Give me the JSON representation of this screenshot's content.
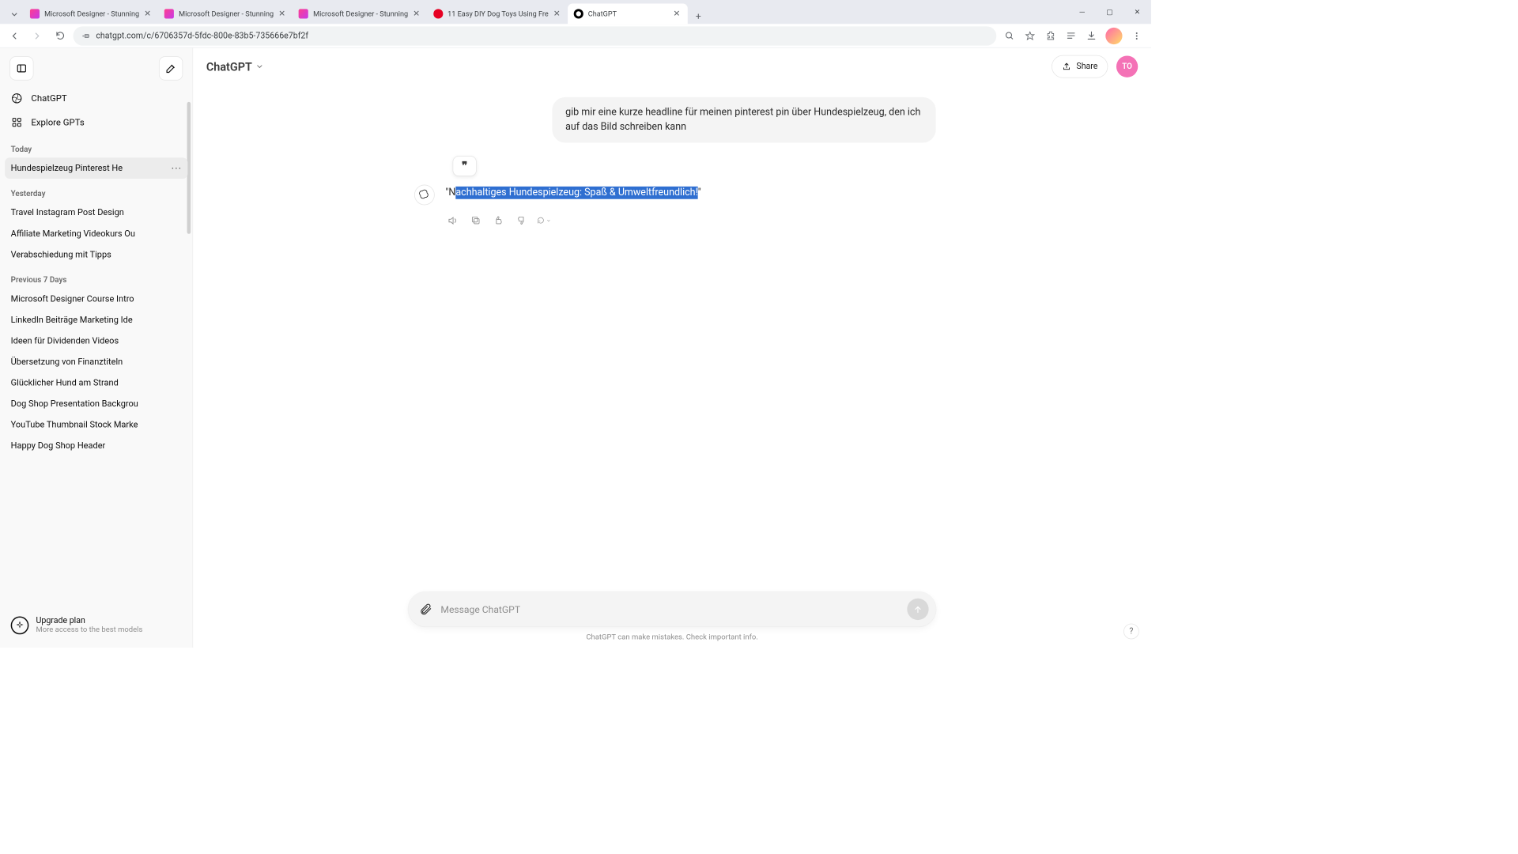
{
  "browser": {
    "tabs": [
      {
        "title": "Microsoft Designer - Stunning"
      },
      {
        "title": "Microsoft Designer - Stunning"
      },
      {
        "title": "Microsoft Designer - Stunning"
      },
      {
        "title": "11 Easy DIY Dog Toys Using Fre"
      },
      {
        "title": "ChatGPT"
      }
    ],
    "active_tab_index": 4,
    "url": "chatgpt.com/c/6706357d-5fdc-800e-83b5-735666e7bf2f"
  },
  "sidebar": {
    "nav_chatgpt": "ChatGPT",
    "nav_explore": "Explore GPTs",
    "sections": {
      "today_label": "Today",
      "yesterday_label": "Yesterday",
      "prev7_label": "Previous 7 Days"
    },
    "today": [
      "Hundespielzeug Pinterest He"
    ],
    "yesterday": [
      "Travel Instagram Post Design",
      "Affiliate Marketing Videokurs Ou",
      "Verabschiedung mit Tipps"
    ],
    "prev7": [
      "Microsoft Designer Course Intro",
      "LinkedIn Beiträge Marketing Ide",
      "Ideen für Dividenden Videos",
      "Übersetzung von Finanztiteln",
      "Glücklicher Hund am Strand",
      "Dog Shop Presentation Backgrou",
      "YouTube Thumbnail Stock Marke",
      "Happy Dog Shop Header"
    ],
    "upgrade_title": "Upgrade plan",
    "upgrade_sub": "More access to the best models"
  },
  "header": {
    "model_label": "ChatGPT",
    "share_label": "Share",
    "avatar_initials": "TO"
  },
  "conversation": {
    "user_message": "gib mir eine kurze headline für meinen pinterest pin über Hundespielzeug, den ich auf das Bild schreiben kann",
    "assistant_prefix": "\"N",
    "assistant_selected": "achhaltiges Hundespielzeug: Spaß & Umweltfreundlich!",
    "assistant_suffix": "\""
  },
  "composer": {
    "placeholder": "Message ChatGPT"
  },
  "disclaimer": "ChatGPT can make mistakes. Check important info.",
  "quote_glyph": "❞",
  "help_glyph": "?"
}
